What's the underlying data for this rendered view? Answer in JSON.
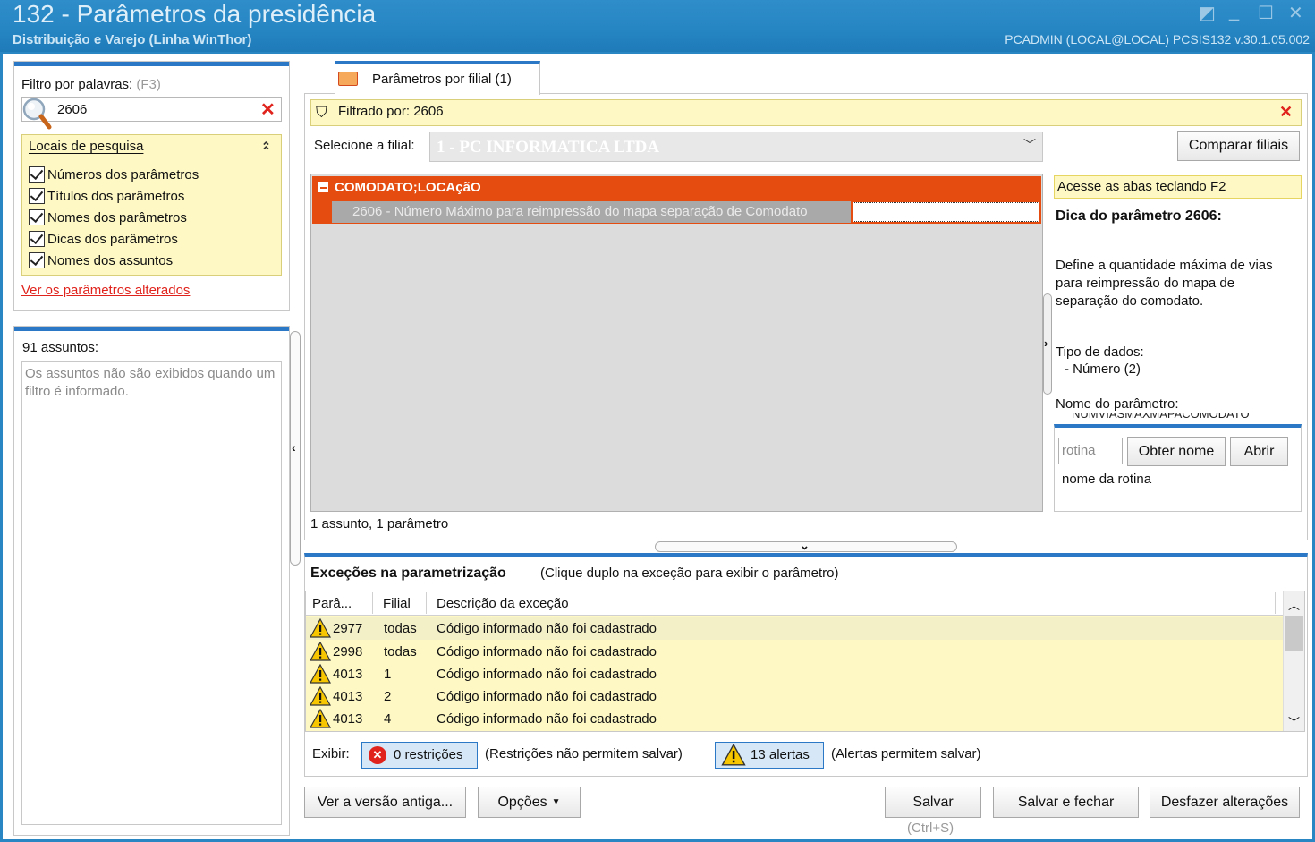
{
  "window": {
    "title": "132 - Parâmetros da presidência",
    "subtitle": "Distribuição e Varejo (Linha WinThor)",
    "user_info": "PCADMIN (LOCAL@LOCAL)   PCSIS132  v.30.1.05.002"
  },
  "filter": {
    "label": "Filtro por palavras:",
    "shortcut": "(F3)",
    "search_value": "2606",
    "locais_title": "Locais de pesquisa",
    "options": [
      {
        "label": "Números dos parâmetros",
        "checked": true
      },
      {
        "label": "Títulos dos parâmetros",
        "checked": true
      },
      {
        "label": "Nomes dos parâmetros",
        "checked": true
      },
      {
        "label": "Dicas dos parâmetros",
        "checked": true
      },
      {
        "label": "Nomes dos assuntos",
        "checked": true
      }
    ],
    "changed_link": "Ver os parâmetros alterados"
  },
  "assuntos": {
    "label": "91 assuntos:",
    "message": "Os assuntos não são exibidos quando um filtro é informado."
  },
  "tab": {
    "label": "Parâmetros por filial  (1)"
  },
  "filtrado": {
    "label": "Filtrado por: 2606"
  },
  "filial": {
    "label": "Selecione a filial:",
    "value": "1 - PC INFORMATICA LTDA",
    "compare_button": "Comparar filiais"
  },
  "tree": {
    "group": "COMODATO;LOCAçãO",
    "row_label": "2606 - Número Máximo para reimpressão do mapa separação de Comodato",
    "row_value": ""
  },
  "count": "1 assunto, 1 parâmetro",
  "help": {
    "f2_hint": "Acesse as abas teclando F2",
    "title": "Dica do parâmetro 2606:",
    "text": "Define a quantidade máxima de vias para reimpressão do mapa de separação do comodato.",
    "tipo_label": "Tipo de dados:",
    "tipo_value": "- Número (2)",
    "nome_label": "Nome do parâmetro:",
    "nome_value": "NUMVIASMAXMAPACOMODATO"
  },
  "rotina": {
    "placeholder": "rotina",
    "obter_button": "Obter nome",
    "abrir_button": "Abrir",
    "name_label": "nome da rotina"
  },
  "exceptions": {
    "title": "Exceções na parametrização",
    "subtitle": "(Clique duplo na exceção para exibir o parâmetro)",
    "columns": [
      "Parâ...",
      "Filial",
      "Descrição da exceção"
    ],
    "rows": [
      {
        "param": "2977",
        "filial": "todas",
        "desc": "Código informado não foi cadastrado"
      },
      {
        "param": "2998",
        "filial": "todas",
        "desc": "Código informado não foi cadastrado"
      },
      {
        "param": "4013",
        "filial": "1",
        "desc": "Código informado não foi cadastrado"
      },
      {
        "param": "4013",
        "filial": "2",
        "desc": "Código informado não foi cadastrado"
      },
      {
        "param": "4013",
        "filial": "4",
        "desc": "Código informado não foi cadastrado"
      }
    ],
    "exibir_label": "Exibir:",
    "restricoes_button": "0 restrições",
    "restricoes_icon": "✕",
    "restricoes_hint": "(Restrições não permitem salvar)",
    "alertas_button": "13 alertas",
    "alertas_hint": "(Alertas permitem salvar)"
  },
  "footer": {
    "versao_button": "Ver a versão antiga...",
    "opcoes_button": "Opções",
    "salvar_button": "Salvar",
    "salvar_hint": "(Ctrl+S)",
    "salvar_fechar_button": "Salvar e fechar",
    "desfazer_button": "Desfazer alterações"
  },
  "colors": {
    "accent": "#2b78c6",
    "orange": "#e44d0f",
    "yellow_bg": "#fdf8c4",
    "red": "#e0231c"
  }
}
